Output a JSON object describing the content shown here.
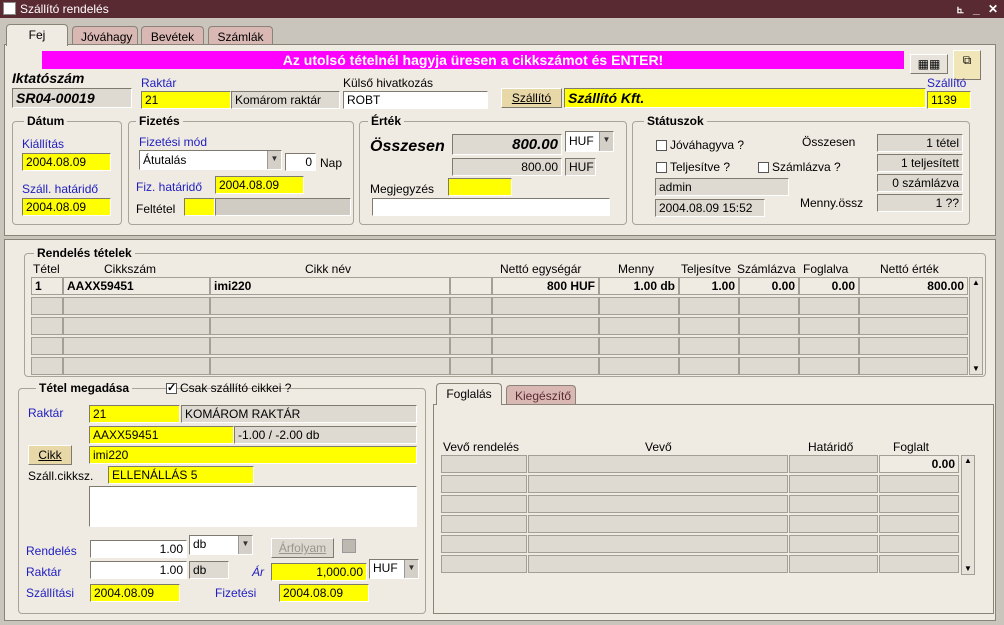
{
  "window": {
    "title": "Szállító rendelés",
    "controls": [
      "⦜",
      "_",
      "✕"
    ]
  },
  "tabs": [
    "Fej",
    "Jóváhagy",
    "Bevétek",
    "Számlák"
  ],
  "banner": "Az utolsó tételnél hagyja üresen a cikkszámot és ENTER!",
  "colors": {
    "banner": "#ff00ff",
    "required": "#ffff00",
    "titlebar": "#5a2a32"
  },
  "header": {
    "iktatoszam_label": "Iktatószám",
    "iktatoszam": "SR04-00019",
    "raktar_label": "Raktár",
    "raktar_code": "21",
    "raktar_name": "Komárom raktár",
    "kulso_label": "Külső hivatkozás",
    "kulso": "ROBT",
    "szallito_button": "Szállító",
    "szallito_name": "Szállító Kft.",
    "szallito_label": "Szállító",
    "szallito_code": "1139"
  },
  "datum": {
    "legend": "Dátum",
    "kiallitas_label": "Kiállítás",
    "kiallitas": "2004.08.09",
    "hatarido_label": "Száll. határidő",
    "hatarido": "2004.08.09"
  },
  "fizetes": {
    "legend": "Fizetés",
    "mod_label": "Fizetési mód",
    "mod": "Átutalás",
    "nap_value": "0",
    "nap_label": "Nap",
    "hatarido_label": "Fiz. határidő",
    "hatarido": "2004.08.09",
    "feltetel_label": "Feltétel"
  },
  "ertek": {
    "legend": "Érték",
    "osszesen_label": "Összesen",
    "osszesen": "800.00",
    "currency": "HUF",
    "osszesen2": "800.00",
    "currency2": "HUF",
    "megjegyzes_label": "Megjegyzés"
  },
  "statusz": {
    "legend": "Státuszok",
    "jovahagyva": "Jóváhagyva ?",
    "teljesitve": "Teljesítve ?",
    "szamlazva": "Számlázva ?",
    "user": "admin",
    "timestamp": "2004.08.09 15:52",
    "osszesen_label": "Összesen",
    "tetel": "1 tétel",
    "teljesitett": "1 teljesített",
    "szamlazva_count": "0 számlázva",
    "menny_label": "Menny.össz",
    "menny": "1 ??"
  },
  "items": {
    "legend": "Rendelés tételek",
    "columns": [
      "Tétel",
      "Cikkszám",
      "Cikk név",
      "Nettó egységár",
      "Menny",
      "Teljesítve",
      "Számlázva",
      "Foglalva",
      "Nettó érték"
    ],
    "rows": [
      [
        "1",
        "AAXX59451",
        "imi220",
        "",
        "800 HUF",
        "1.00 db",
        "1.00",
        "0.00",
        "0.00",
        "800.00"
      ]
    ]
  },
  "tetel": {
    "legend": "Tétel megadása",
    "csak_label": "Csak szállító cikkei ?",
    "raktar_label": "Raktár",
    "raktar_code": "21",
    "raktar_name": "KOMÁROM RAKTÁR",
    "cikkszam": "AAXX59451",
    "stock": "-1.00 / -2.00 db",
    "cikk_button": "Cikk",
    "cikk_nev": "imi220",
    "szall_cikksz_label": "Száll.cikksz.",
    "szall_cikksz": "ELLENÁLLÁS 5",
    "rendeles_label": "Rendelés",
    "rendeles": "1.00",
    "rendeles_unit": "db",
    "arfolyam_button": "Árfolyam",
    "raktar2_label": "Raktár",
    "raktar2": "1.00",
    "raktar2_unit": "db",
    "ar_label": "Ár",
    "ar": "1,000.00",
    "ar_currency": "HUF",
    "szallitasi_label": "Szállítási",
    "szallitasi": "2004.08.09",
    "fizetesi_label": "Fizetési",
    "fizetesi": "2004.08.09"
  },
  "foglalas": {
    "tabs": [
      "Foglalás",
      "Kiegészítő"
    ],
    "columns": [
      "Vevő rendelés",
      "Vevő",
      "Határidő",
      "Foglalt"
    ],
    "total": "0.00"
  }
}
